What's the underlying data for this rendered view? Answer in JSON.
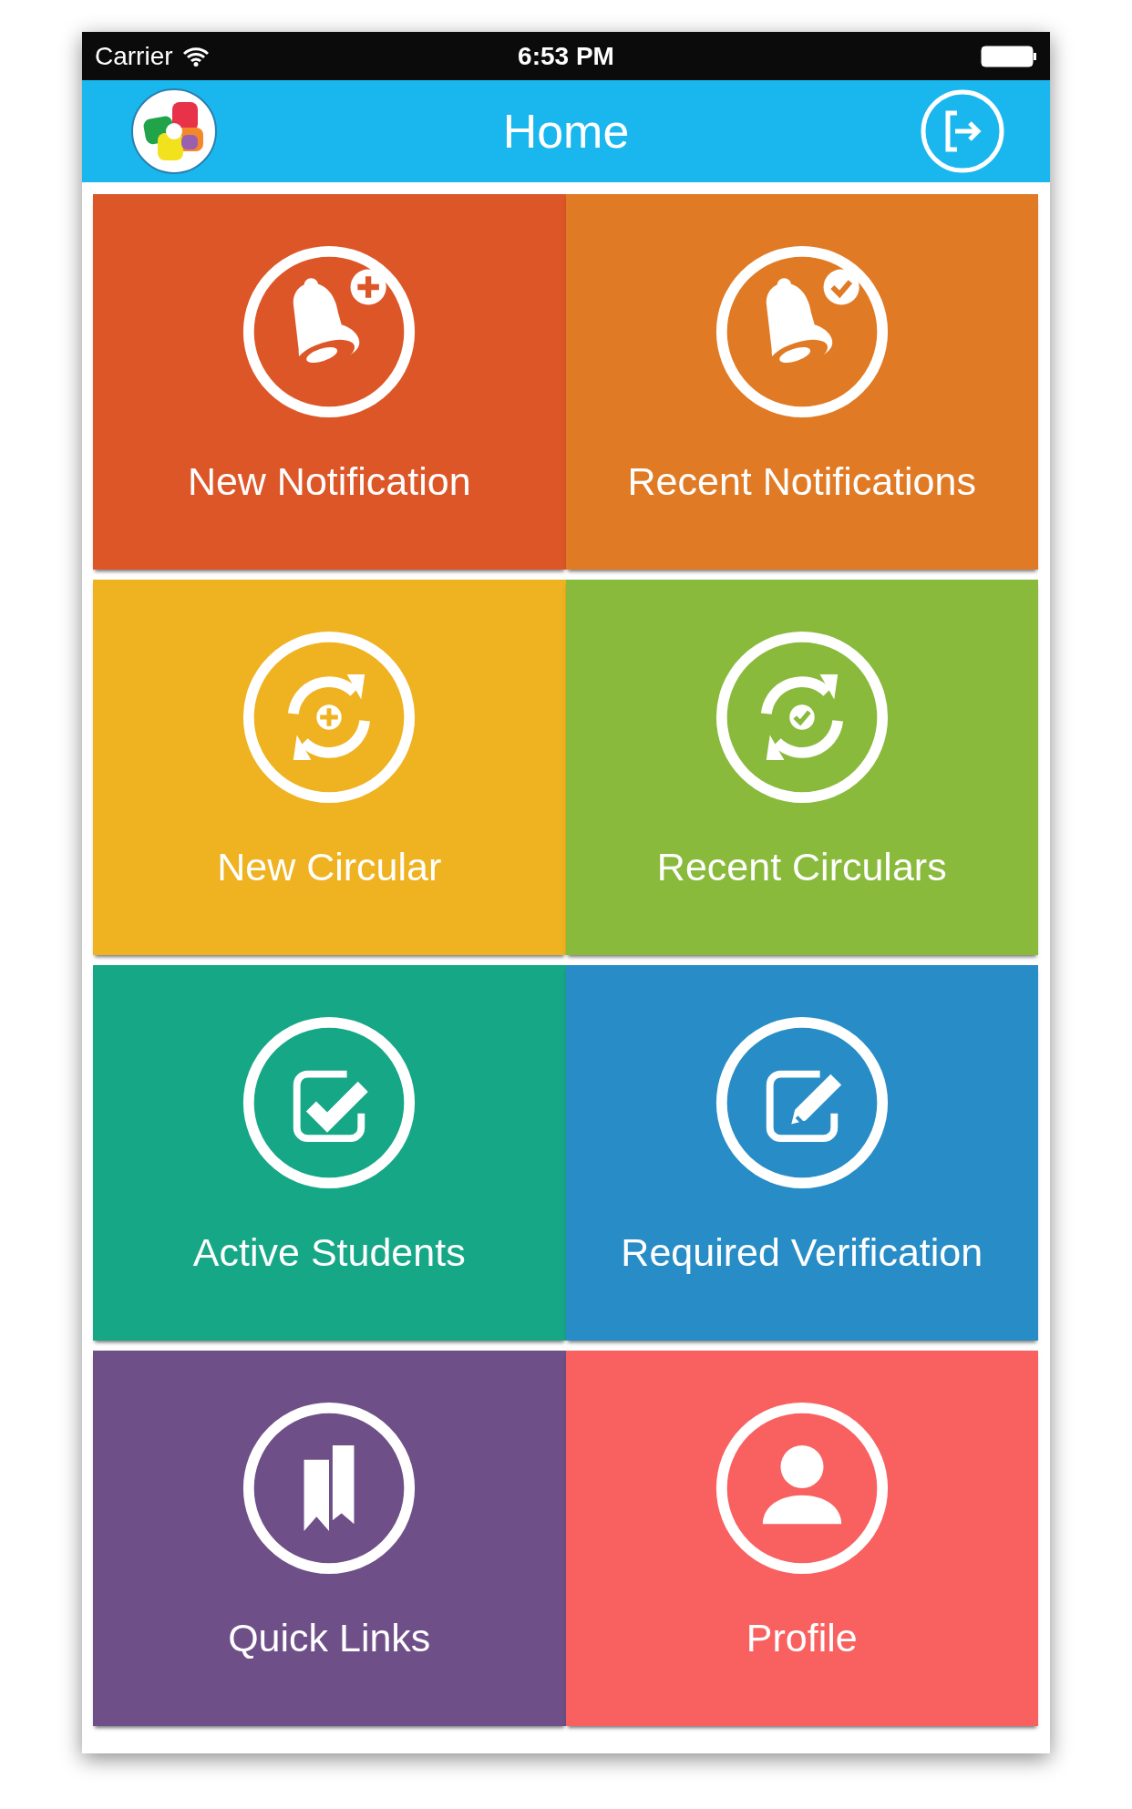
{
  "status_bar": {
    "carrier": "Carrier",
    "time": "6:53 PM"
  },
  "nav_bar": {
    "title": "Home"
  },
  "tiles": [
    {
      "label": "New Notification",
      "kind": "bellplus",
      "color": "#dd5628"
    },
    {
      "label": "Recent Notifications",
      "kind": "bellcheck",
      "color": "#e07a24"
    },
    {
      "label": "New Circular",
      "kind": "syncplus",
      "color": "#efb220"
    },
    {
      "label": "Recent Circulars",
      "kind": "synccheck",
      "color": "#89ba3c"
    },
    {
      "label": "Active Students",
      "kind": "checkbox",
      "color": "#16a786"
    },
    {
      "label": "Required Verification",
      "kind": "edit",
      "color": "#288dc6"
    },
    {
      "label": "Quick Links",
      "kind": "bookmark",
      "color": "#6e4f87"
    },
    {
      "label": "Profile",
      "kind": "person",
      "color": "#f96160"
    }
  ]
}
